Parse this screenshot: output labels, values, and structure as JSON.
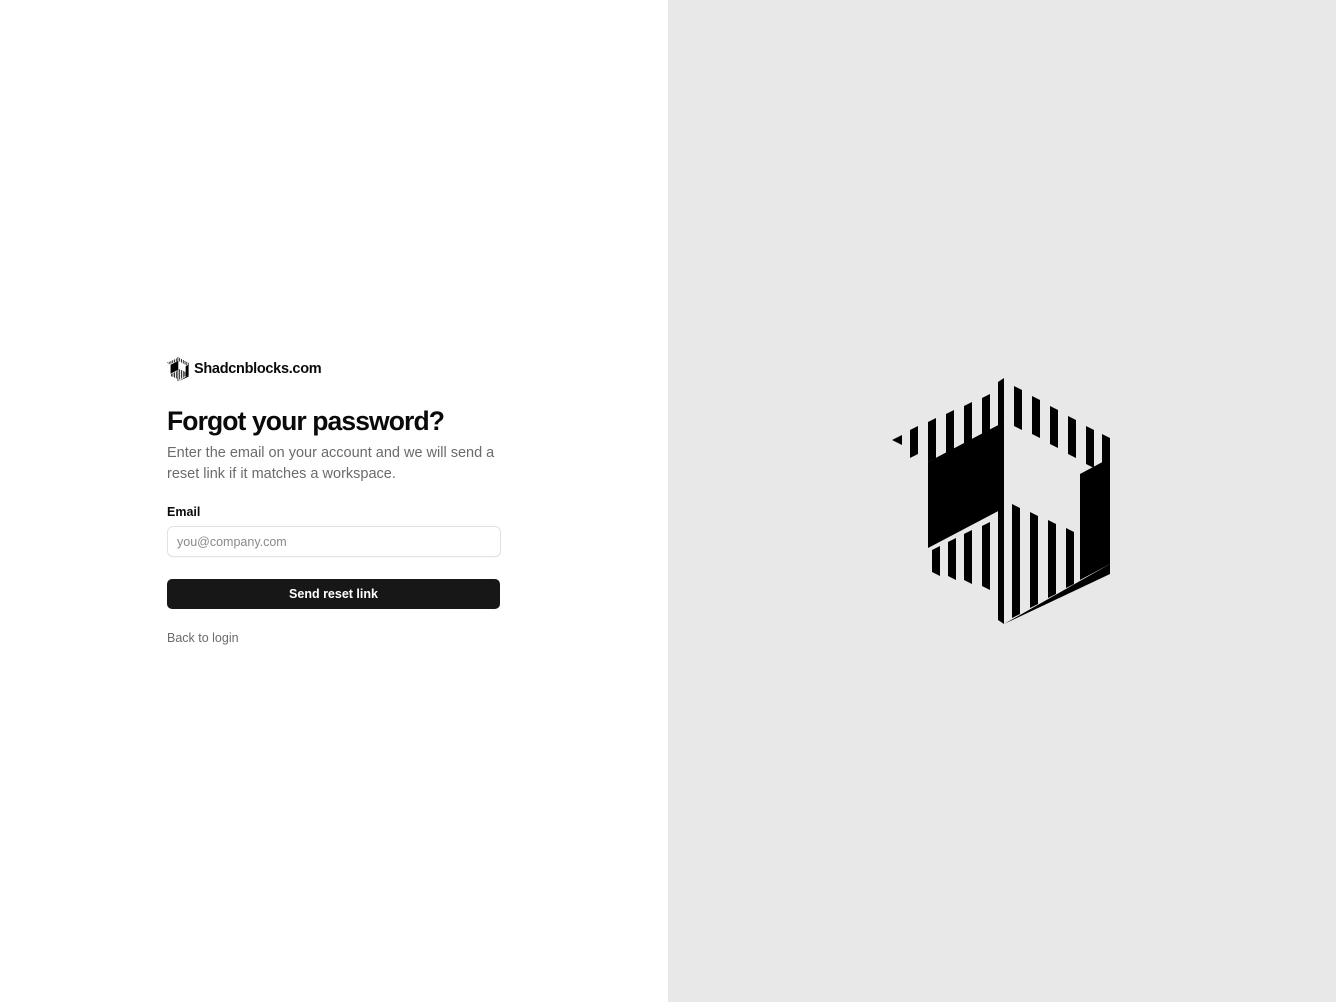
{
  "brand": {
    "name": "Shadcnblocks.com",
    "logo_icon": "shadcnblocks-logo-icon"
  },
  "form": {
    "title": "Forgot your password?",
    "subtitle": "Enter the email on your account and we will send a reset link if it matches a workspace.",
    "email_label": "Email",
    "email_placeholder": "you@company.com",
    "email_value": "",
    "submit_label": "Send reset link",
    "back_link_label": "Back to login"
  },
  "hero": {
    "icon": "shadcnblocks-logo-icon",
    "background": "#e8e8e8"
  },
  "colors": {
    "primary_button": "#171717",
    "muted_text": "#6b6b6b",
    "border": "#e2e2e2"
  }
}
